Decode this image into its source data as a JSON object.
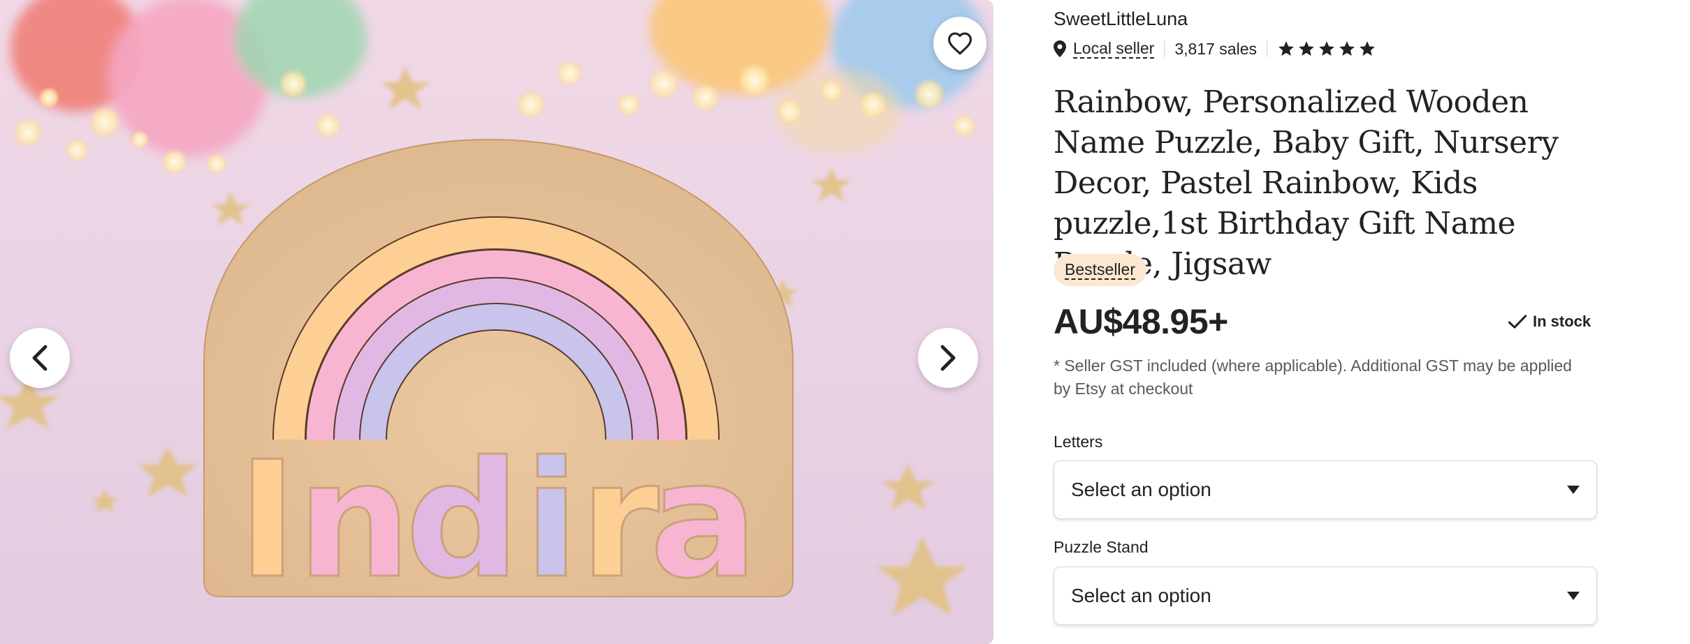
{
  "gallery": {
    "favorite_icon": "heart-icon",
    "prev_icon": "chevron-left-icon",
    "next_icon": "chevron-right-icon",
    "product_photo_text": "Indira"
  },
  "shop": {
    "name": "SweetLittleLuna",
    "location_icon": "map-pin-icon",
    "local_seller_label": "Local seller",
    "sales": "3,817 sales",
    "rating_stars": 5
  },
  "listing": {
    "title": "Rainbow, Personalized Wooden Name Puzzle, Baby Gift, Nursery Decor, Pastel Rainbow, Kids puzzle,1st Birthday Gift Name Puzzle, Jigsaw",
    "badge": "Bestseller",
    "price": "AU$48.95+",
    "stock_status": "In stock",
    "gst_note": "* Seller GST included (where applicable). Additional GST may be applied by Etsy at checkout"
  },
  "options": [
    {
      "label": "Letters",
      "selected": "Select an option"
    },
    {
      "label": "Puzzle Stand",
      "selected": "Select an option"
    }
  ],
  "colors": {
    "badge_bg": "#fce8d0",
    "text": "#222222",
    "muted_text": "#595959"
  }
}
